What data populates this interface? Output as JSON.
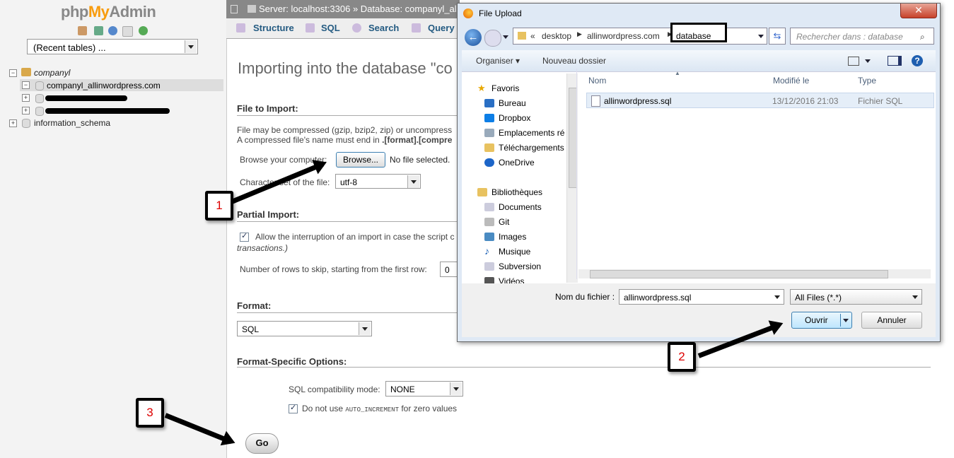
{
  "nav": {
    "logo_php": "php",
    "logo_my": "My",
    "logo_admin": "Admin",
    "recent_tables": "(Recent tables) ...",
    "tree": {
      "root": "companyl",
      "selected": "companyl_allinwordpress.com",
      "info_schema": "information_schema"
    }
  },
  "pma": {
    "breadcrumb": "Server: localhost:3306 » Database: companyl_al",
    "tabs": [
      "Structure",
      "SQL",
      "Search",
      "Query"
    ],
    "title": "Importing into the database \"co",
    "file_section": "File to Import:",
    "compress_line1": "File may be compressed (gzip, bzip2, zip) or uncompress",
    "compress_line2": "A compressed file's name must end in ",
    "compress_line2_bold": ".[format].[compre",
    "browse_label": "Browse your computer:",
    "browse_button": "Browse...",
    "no_file": "No file selected.",
    "charset_label": "Character set of the file:",
    "charset_value": "utf-8",
    "partial_section": "Partial Import:",
    "allow_interrupt": "Allow the interruption of an import in case the script c",
    "transactions": "transactions.)",
    "skip_rows_label": "Number of rows to skip, starting from the first row:",
    "skip_rows_value": "0",
    "format_section": "Format:",
    "format_value": "SQL",
    "format_specific_section": "Format-Specific Options:",
    "sql_compat_label": "SQL compatibility mode:",
    "sql_compat_value": "NONE",
    "auto_inc_pre": "Do not use ",
    "auto_inc_code": "AUTO_INCREMENT",
    "auto_inc_post": " for zero values",
    "go_button": "Go"
  },
  "dialog": {
    "title": "File Upload",
    "close": "✕",
    "address": {
      "prefix": "«",
      "parts": [
        "desktop",
        "allinwordpress.com",
        "database"
      ]
    },
    "search_placeholder": "Rechercher dans : database",
    "toolbar": {
      "organize": "Organiser ▾",
      "new_folder": "Nouveau dossier"
    },
    "sidebar": {
      "favorites": "Favoris",
      "favorites_items": [
        "Bureau",
        "Dropbox",
        "Emplacements ré",
        "Téléchargements",
        "OneDrive"
      ],
      "libraries": "Bibliothèques",
      "libraries_items": [
        "Documents",
        "Git",
        "Images",
        "Musique",
        "Subversion",
        "Vidéos"
      ]
    },
    "columns": [
      "Nom",
      "Modifié le",
      "Type"
    ],
    "files": [
      {
        "name": "allinwordpress.sql",
        "modified": "13/12/2016 21:03",
        "type": "Fichier SQL"
      }
    ],
    "filename_label": "Nom du fichier :",
    "filename_value": "allinwordpress.sql",
    "filter_value": "All Files (*.*)",
    "open_button": "Ouvrir",
    "cancel_button": "Annuler"
  },
  "callouts": [
    "1",
    "2",
    "3"
  ]
}
